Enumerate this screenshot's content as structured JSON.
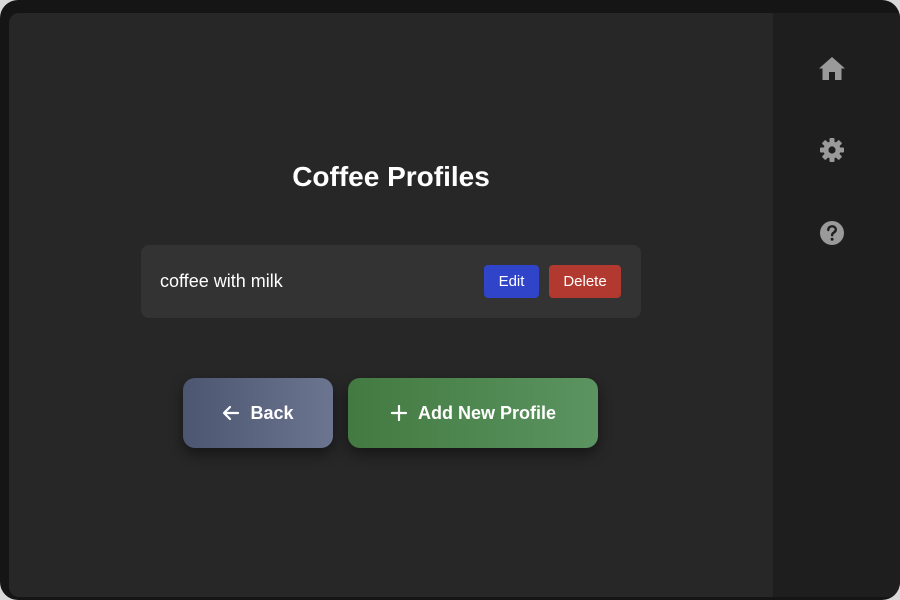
{
  "page": {
    "title": "Coffee Profiles"
  },
  "profiles": [
    {
      "name": "coffee with milk",
      "edit_label": "Edit",
      "delete_label": "Delete"
    }
  ],
  "actions": {
    "back_label": "Back",
    "add_label": "Add New Profile"
  },
  "sidebar": {
    "items": [
      {
        "icon": "home-icon"
      },
      {
        "icon": "gear-icon"
      },
      {
        "icon": "help-icon"
      }
    ]
  },
  "colors": {
    "edit": "#2f44c8",
    "delete": "#b2392f",
    "back": "#5b6580",
    "add": "#4e8750",
    "icon": "#9a9a9a"
  }
}
